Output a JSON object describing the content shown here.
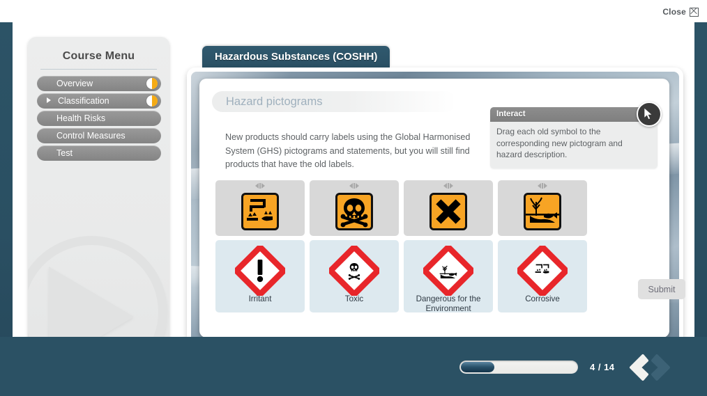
{
  "window": {
    "close_label": "Close",
    "close_icon": "close-box-icon"
  },
  "sidebar": {
    "title": "Course Menu",
    "items": [
      {
        "label": "Overview",
        "has_arrow": false,
        "badge": "half-circle-amber"
      },
      {
        "label": "Classification",
        "has_arrow": true,
        "badge": "half-circle-amber"
      },
      {
        "label": "Health Risks",
        "has_arrow": false,
        "badge": null
      },
      {
        "label": "Control Measures",
        "has_arrow": false,
        "badge": null
      },
      {
        "label": "Test",
        "has_arrow": false,
        "badge": null
      }
    ],
    "watermark_icon": "play-button-icon"
  },
  "header": {
    "tab_title": "Hazardous Substances (COSHH)"
  },
  "content": {
    "card_title": "Hazard pictograms",
    "body_text": "New products should carry labels using the Global Harmonised System (GHS) pictograms and statements, but you will still find products that have the old labels.",
    "interact": {
      "heading": "Interact",
      "instruction": "Drag each old symbol to the corresponding new pictogram and hazard description.",
      "icon": "mouse-cursor-icon"
    },
    "old_symbols": [
      {
        "name": "corrosive-old-symbol",
        "icon": "corrosive-icon",
        "handle": "drag-handle-icon"
      },
      {
        "name": "toxic-old-symbol",
        "icon": "skull-icon",
        "handle": "drag-handle-icon"
      },
      {
        "name": "harmful-old-symbol",
        "icon": "x-cross-icon",
        "handle": "drag-handle-icon"
      },
      {
        "name": "environment-old-symbol",
        "icon": "tree-fish-icon",
        "handle": "drag-handle-icon"
      }
    ],
    "new_pictograms": [
      {
        "label": "Irritant",
        "icon": "exclamation-diamond-icon"
      },
      {
        "label": "Toxic",
        "icon": "skull-diamond-icon"
      },
      {
        "label": "Dangerous for the Environment",
        "icon": "environment-diamond-icon"
      },
      {
        "label": "Corrosive",
        "icon": "corrosive-diamond-icon"
      }
    ],
    "submit_label": "Submit"
  },
  "footer": {
    "page_indicator": "4 / 14",
    "progress_percent": 29,
    "prev_icon": "chevron-left-icon",
    "next_icon": "chevron-right-icon"
  },
  "colors": {
    "shell": "#2b5164",
    "gold": "#f0bf1d",
    "old_symbol_orange": "#f7a424",
    "ghs_red": "#e8262a",
    "badge_amber": "#f5ab14",
    "tile_grey": "#d8d8d8",
    "tile_blue": "#dde9ef"
  }
}
